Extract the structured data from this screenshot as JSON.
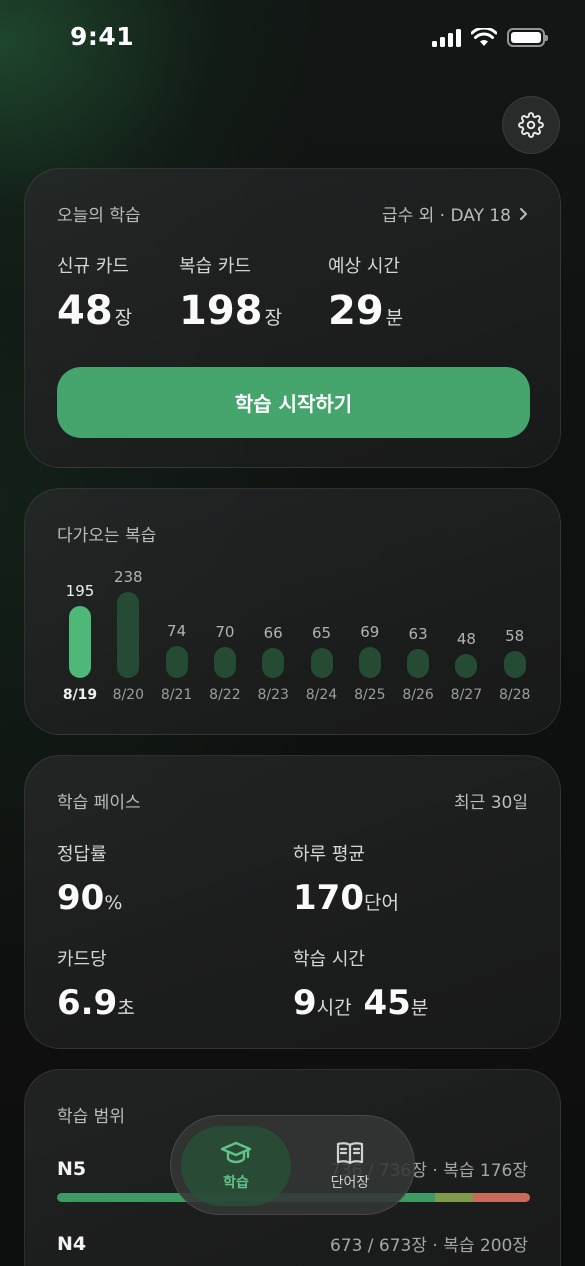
{
  "status_bar": {
    "time": "9:41"
  },
  "today": {
    "title": "오늘의 학습",
    "link": "급수 외 · DAY 18",
    "stats": [
      {
        "label": "신규 카드",
        "value": "48",
        "unit": "장"
      },
      {
        "label": "복습 카드",
        "value": "198",
        "unit": "장"
      },
      {
        "label": "예상 시간",
        "value": "29",
        "unit": "분"
      }
    ],
    "start_button": "학습 시작하기"
  },
  "upcoming": {
    "title": "다가오는 복습",
    "chart_data": {
      "type": "bar",
      "categories": [
        "8/19",
        "8/20",
        "8/21",
        "8/22",
        "8/23",
        "8/24",
        "8/25",
        "8/26",
        "8/27",
        "8/28"
      ],
      "values": [
        195,
        238,
        74,
        70,
        66,
        65,
        69,
        63,
        48,
        58
      ],
      "highlight_index": 0,
      "colors": {
        "highlight": "#4db878",
        "normal": "#254b34"
      }
    }
  },
  "pace": {
    "title": "학습 페이스",
    "period": "최근 30일",
    "accuracy": {
      "label": "정답률",
      "value": "90",
      "unit": "%"
    },
    "daily_avg": {
      "label": "하루 평균",
      "value": "170",
      "unit": "단어"
    },
    "per_card": {
      "label": "카드당",
      "value": "6.9",
      "unit": "초"
    },
    "study_time": {
      "label": "학습 시간",
      "hours": "9",
      "hours_unit": "시간",
      "minutes": "45",
      "minutes_unit": "분"
    }
  },
  "range": {
    "title": "학습 범위",
    "levels": [
      {
        "level": "N5",
        "info": "736 / 736장 · 복습 176장",
        "segments": [
          0.8,
          0.08,
          0.12
        ]
      },
      {
        "level": "N4",
        "info": "673 / 673장 · 복습 200장"
      }
    ],
    "colors": {
      "learned": "#3d9a62",
      "review": "#7f9a4a",
      "hard": "#c86b5c"
    }
  },
  "tabbar": {
    "tabs": [
      {
        "label": "학습",
        "icon": "graduation-cap-icon",
        "active": true
      },
      {
        "label": "단어장",
        "icon": "book-icon",
        "active": false
      }
    ]
  }
}
